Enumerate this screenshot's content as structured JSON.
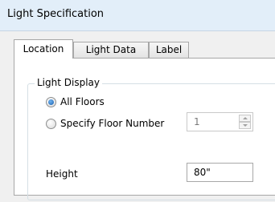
{
  "window": {
    "title": "Light Specification"
  },
  "tabs": [
    {
      "label": "Location",
      "active": true
    },
    {
      "label": "Light Data",
      "active": false
    },
    {
      "label": "Label",
      "active": false
    }
  ],
  "light_display": {
    "legend": "Light Display",
    "options": [
      {
        "label": "All Floors",
        "selected": true
      },
      {
        "label": "Specify Floor Number",
        "selected": false
      }
    ],
    "floor_number": {
      "value": "1",
      "enabled": false
    }
  },
  "height": {
    "label": "Height",
    "value": "80\""
  },
  "colors": {
    "titlebar_bg": "#e2eef9",
    "dialog_bg": "#f0f0f0",
    "panel_bg": "#ffffff",
    "radio_selected": "#1a5fae"
  }
}
